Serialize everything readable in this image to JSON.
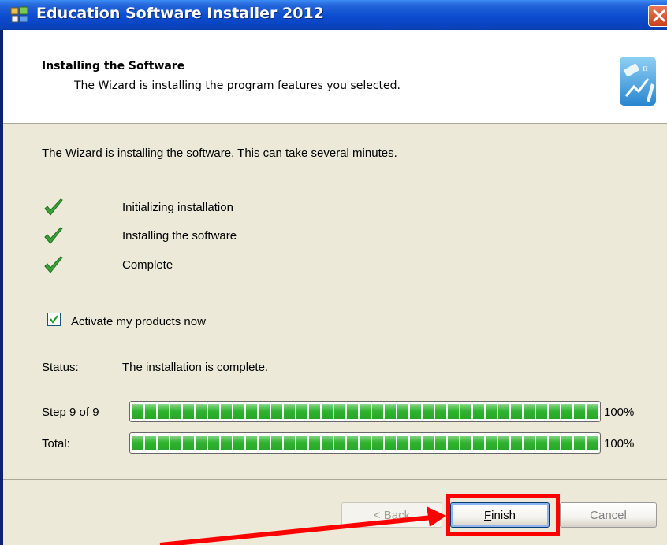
{
  "window": {
    "title": "Education Software Installer 2012",
    "icons": {
      "app": "installer-app-icon",
      "close": "close-icon"
    }
  },
  "header": {
    "title": "Installing the Software",
    "subtitle": "The Wizard is installing the program features you selected.",
    "icon": "education-logo-icon"
  },
  "body": {
    "intro": "The Wizard is installing the software. This can take several minutes.",
    "steps": [
      {
        "label": "Initializing installation",
        "status": "done"
      },
      {
        "label": "Installing the software",
        "status": "done"
      },
      {
        "label": "Complete",
        "status": "done"
      }
    ],
    "activate": {
      "label": "Activate my products now",
      "checked": true
    },
    "status": {
      "label": "Status:",
      "value": "The installation is complete."
    },
    "progress": [
      {
        "label": "Step 9 of 9",
        "value": 1.0,
        "percent_text": "100%"
      },
      {
        "label": "Total:",
        "value": 1.0,
        "percent_text": "100%"
      }
    ]
  },
  "footer": {
    "back_label": "< Back",
    "finish_label": "Finish",
    "cancel_label": "Cancel"
  },
  "annotation": {
    "color": "#ff0000",
    "target": "finish-button"
  },
  "colors": {
    "titlebar": "#0c4cd0",
    "dialog_bg": "#ece9d8",
    "progress_green": "#2fb52f",
    "check_green": "#3aa23a"
  }
}
